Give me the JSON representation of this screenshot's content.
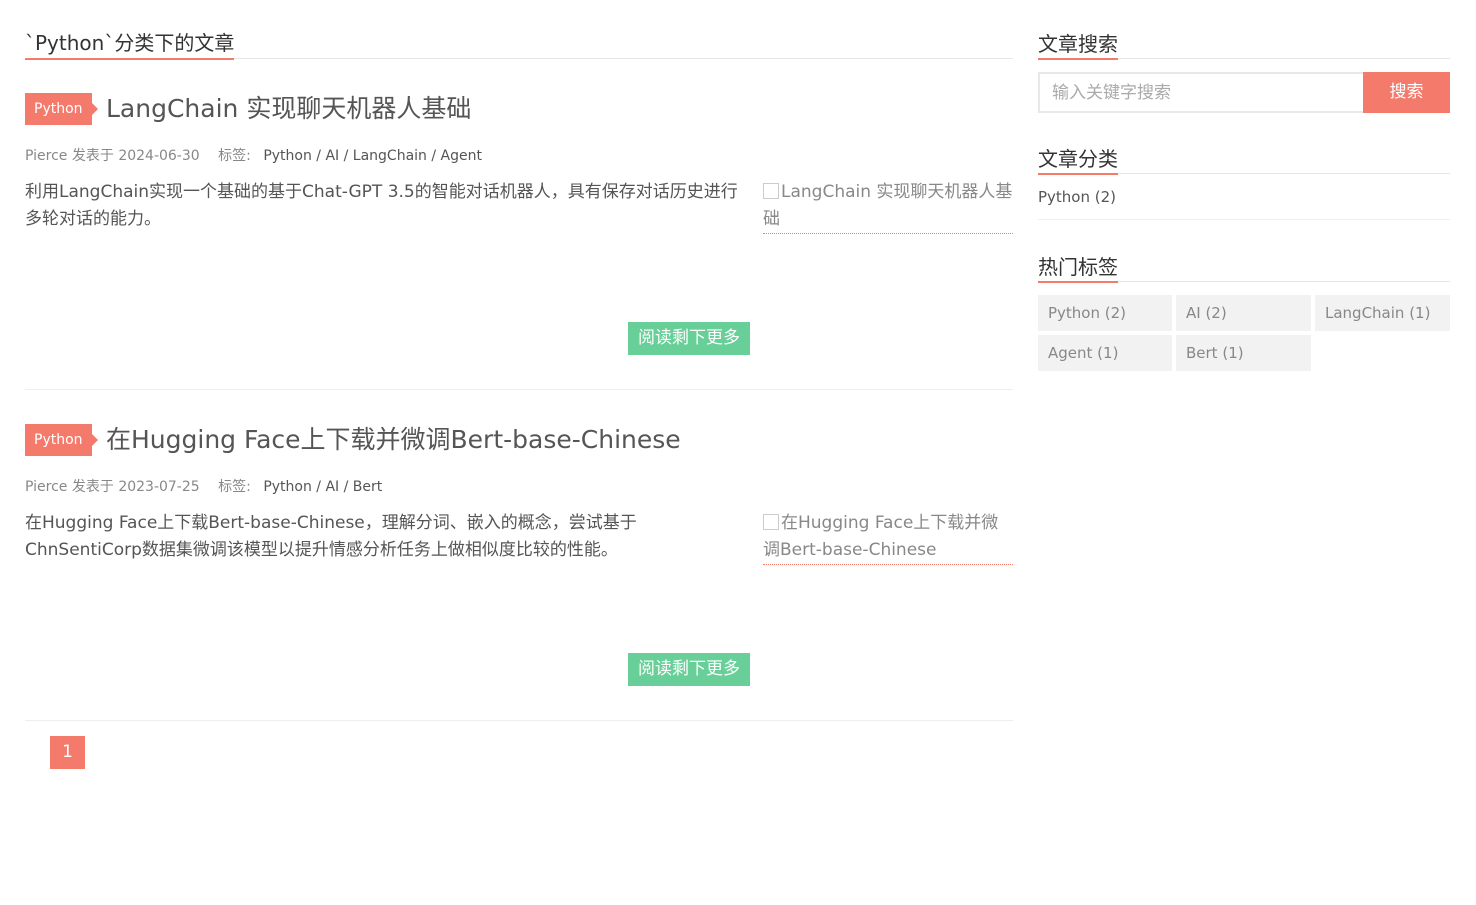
{
  "page_title": "`Python`分类下的文章",
  "articles": [
    {
      "category": "Python",
      "title": "LangChain 实现聊天机器人基础",
      "author": "Pierce",
      "published_label": "发表于",
      "date": "2024-06-30",
      "tags_label": "标签:",
      "tags": "Python / AI / LangChain / Agent",
      "excerpt": "利用LangChain实现一个基础的基于Chat-GPT 3.5的智能对话机器人，具有保存对话历史进行多轮对话的能力。",
      "thumb_alt": "LangChain 实现聊天机器人基础",
      "read_more": "阅读剩下更多"
    },
    {
      "category": "Python",
      "title": "在Hugging Face上下载并微调Bert-base-Chinese",
      "author": "Pierce",
      "published_label": "发表于",
      "date": "2023-07-25",
      "tags_label": "标签:",
      "tags": "Python / AI / Bert",
      "excerpt": "在Hugging Face上下载Bert-base-Chinese，理解分词、嵌入的概念，尝试基于ChnSentiCorp数据集微调该模型以提升情感分析任务上做相似度比较的性能。",
      "thumb_alt": "在Hugging Face上下载并微调Bert-base-Chinese",
      "read_more": "阅读剩下更多"
    }
  ],
  "pagination": {
    "current": "1"
  },
  "sidebar": {
    "search": {
      "title": "文章搜索",
      "placeholder": "输入关键字搜索",
      "button": "搜索"
    },
    "categories": {
      "title": "文章分类",
      "items": [
        "Python (2)"
      ]
    },
    "hot_tags": {
      "title": "热门标签",
      "items": [
        "Python (2)",
        "AI (2)",
        "LangChain (1)",
        "Agent (1)",
        "Bert (1)"
      ]
    }
  },
  "colors": {
    "accent": "#f47b6c",
    "read_more": "#67cf97"
  }
}
